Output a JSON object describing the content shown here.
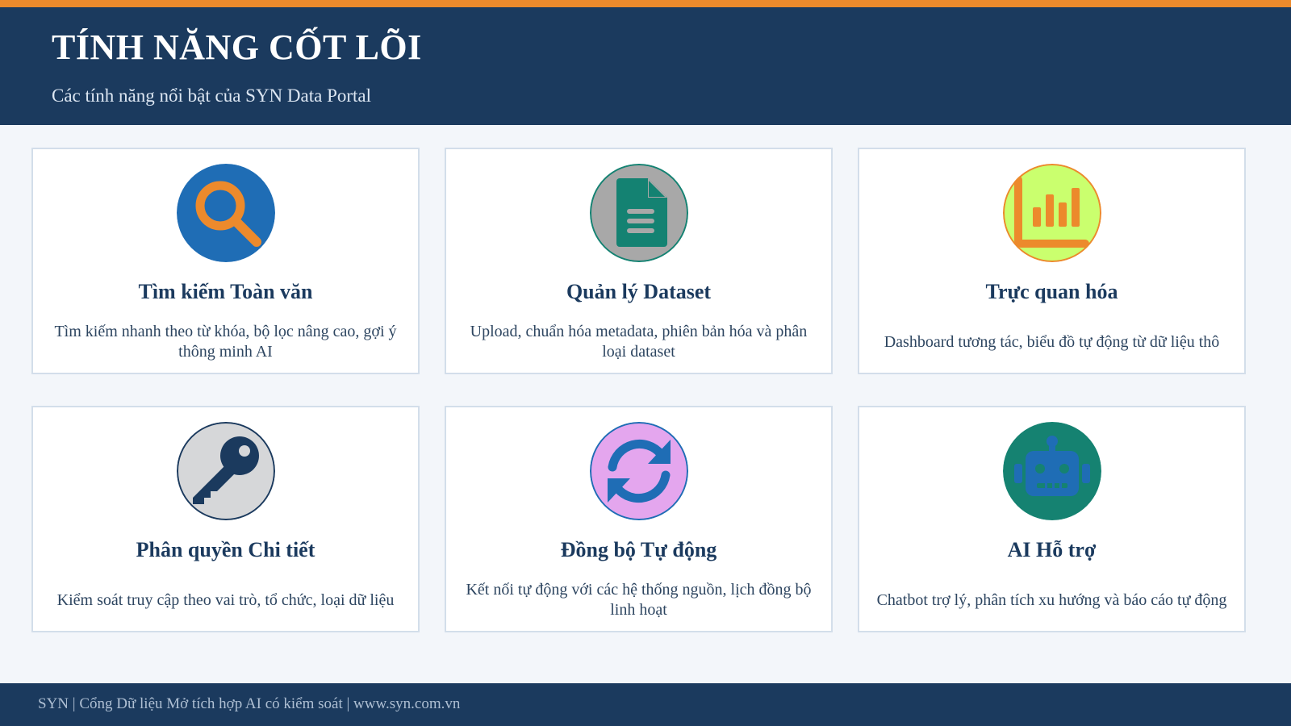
{
  "header": {
    "title": "TÍNH NĂNG CỐT LÕI",
    "subtitle": "Các tính năng nổi bật của SYN Data Portal"
  },
  "colors": {
    "header_bg": "#1b3a5e",
    "accent_stripe": "#ec8a2c",
    "page_bg": "#f3f6fa",
    "card_border": "#d3deea"
  },
  "features": [
    {
      "title": "Tìm kiếm Toàn văn",
      "description": "Tìm kiếm nhanh theo từ khóa, bộ lọc nâng cao, gợi ý thông minh AI",
      "icon": "search-icon",
      "icon_bg": "#1f6db5",
      "icon_fg": "#ec8a2c"
    },
    {
      "title": "Quản lý Dataset",
      "description": "Upload, chuẩn hóa metadata, phiên bản hóa và phân loại dataset",
      "icon": "document-icon",
      "icon_bg": "#a8a8a8",
      "icon_fg": "#148272"
    },
    {
      "title": "Trực quan hóa",
      "description": "Dashboard tương tác, biểu đồ tự động từ dữ liệu thô",
      "icon": "bar-chart-icon",
      "icon_bg": "#caff6e",
      "icon_fg": "#ec8a2c"
    },
    {
      "title": "Phân quyền Chi tiết",
      "description": "Kiểm soát truy cập theo vai trò, tổ chức, loại dữ liệu",
      "icon": "key-icon",
      "icon_bg": "#d6d7d9",
      "icon_fg": "#1b3a5e"
    },
    {
      "title": "Đồng bộ Tự động",
      "description": "Kết nối tự động với các hệ thống nguồn, lịch đồng bộ linh hoạt",
      "icon": "sync-icon",
      "icon_bg": "#e4a6ee",
      "icon_fg": "#1f6db5"
    },
    {
      "title": "AI Hỗ trợ",
      "description": "Chatbot trợ lý, phân tích xu hướng và báo cáo tự động",
      "icon": "robot-icon",
      "icon_bg": "#158271",
      "icon_fg": "#1f6db5"
    }
  ],
  "footer": {
    "text": "SYN | Cổng Dữ liệu Mở tích hợp AI có kiểm soát | www.syn.com.vn"
  }
}
